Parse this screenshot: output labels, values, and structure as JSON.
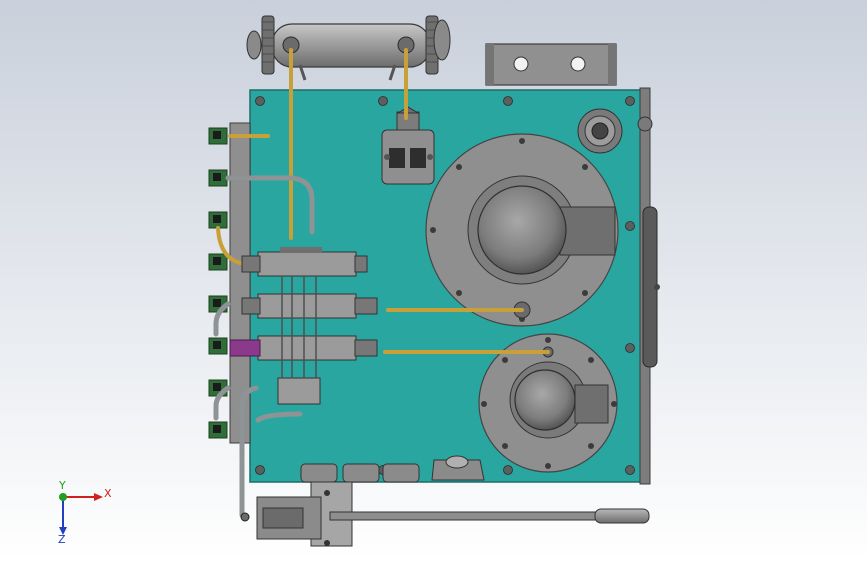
{
  "viewport": {
    "background_top": "#c9d0db",
    "background_bottom": "#ffffff"
  },
  "colors": {
    "plate": "#2aa6a0",
    "steel": "#9a9a9a",
    "steel_dark": "#5f5f5f",
    "copper_pipe": "#c8a03a",
    "grey_pipe": "#8e9396",
    "mount_green": "#2f6e38",
    "purple_fitting": "#8b3a8b"
  },
  "triad": {
    "x_label": "X",
    "y_label": "Y",
    "z_label": "Z",
    "x_color": "#d02020",
    "y_color": "#20a020",
    "z_color": "#2040c0"
  }
}
